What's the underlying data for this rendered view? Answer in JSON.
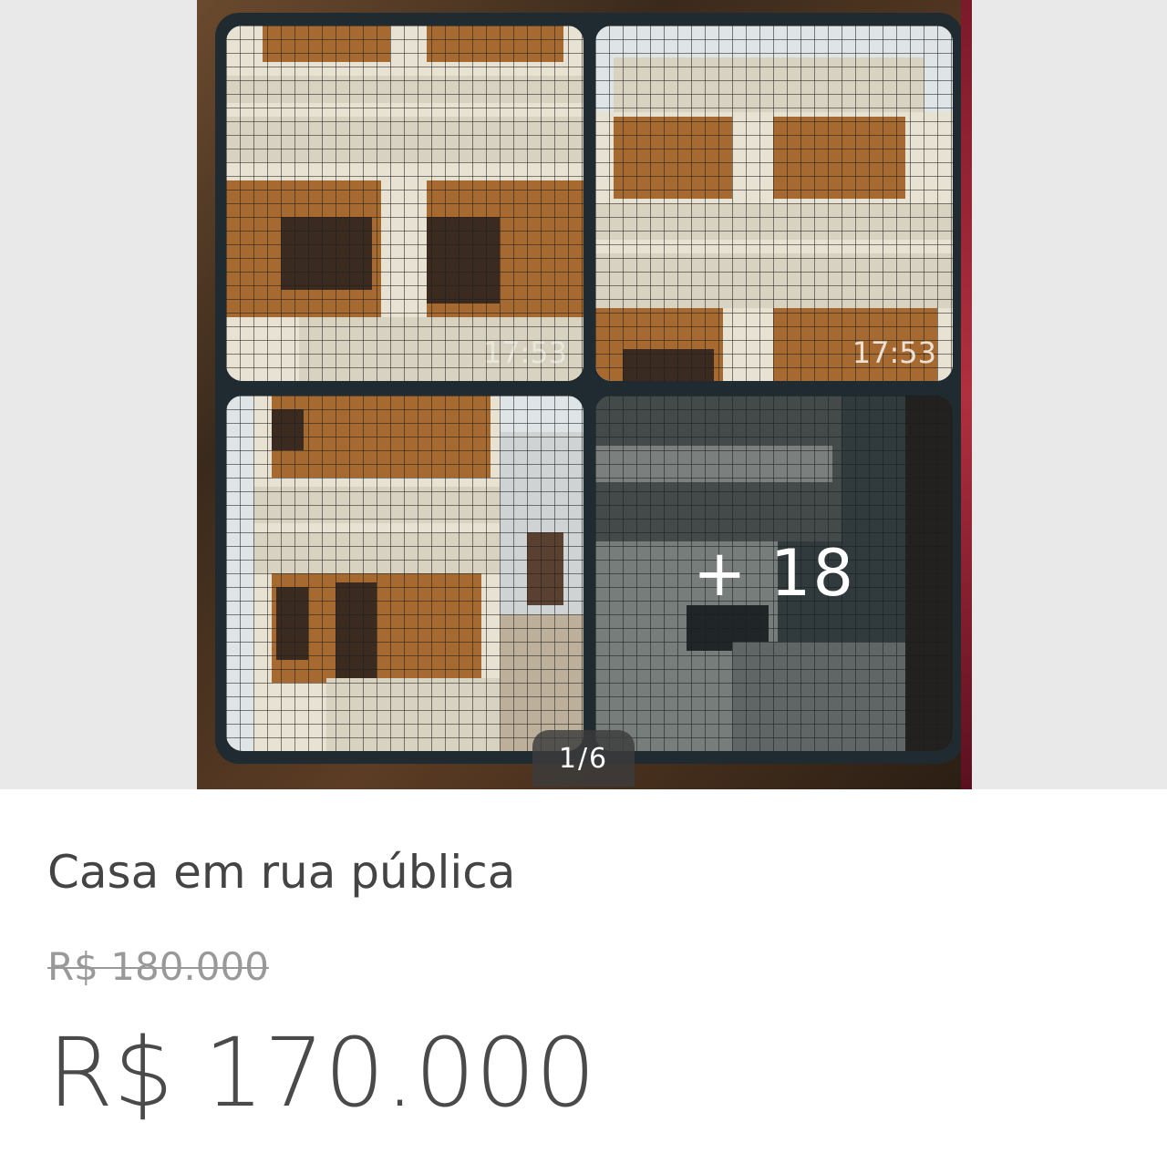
{
  "gallery": {
    "counter": "1/6",
    "tiles": [
      {
        "timestamp": "17:53"
      },
      {
        "timestamp": "17:53"
      },
      {
        "timestamp": ""
      },
      {
        "more_label": "+ 18"
      }
    ]
  },
  "listing": {
    "title": "Casa em rua pública",
    "old_price": "R$ 180.000",
    "price": "R$ 170.000"
  }
}
